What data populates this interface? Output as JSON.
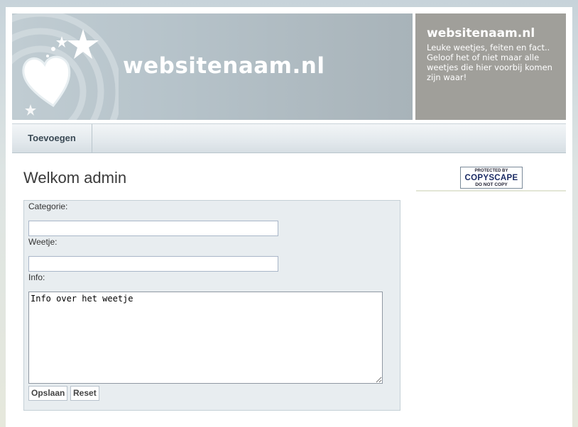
{
  "header": {
    "site_title": "websitenaam.nl",
    "side_title": "websitenaam.nl",
    "side_text": "Leuke weetjes, feiten en fact.. Geloof het of niet maar alle weetjes die hier voorbij komen zijn waar!"
  },
  "nav": {
    "items": [
      {
        "label": "Toevoegen"
      }
    ]
  },
  "main": {
    "heading": "Welkom admin",
    "form": {
      "categorie_label": "Categorie:",
      "categorie_value": "",
      "weetje_label": "Weetje:",
      "weetje_value": "",
      "info_label": "Info:",
      "info_value": "Info over het weetje",
      "save_label": "Opslaan",
      "reset_label": "Reset"
    }
  },
  "sidebar": {
    "badge_top": "PROTECTED BY",
    "badge_main": "COPYSCAPE",
    "badge_bottom": "DO NOT COPY"
  }
}
